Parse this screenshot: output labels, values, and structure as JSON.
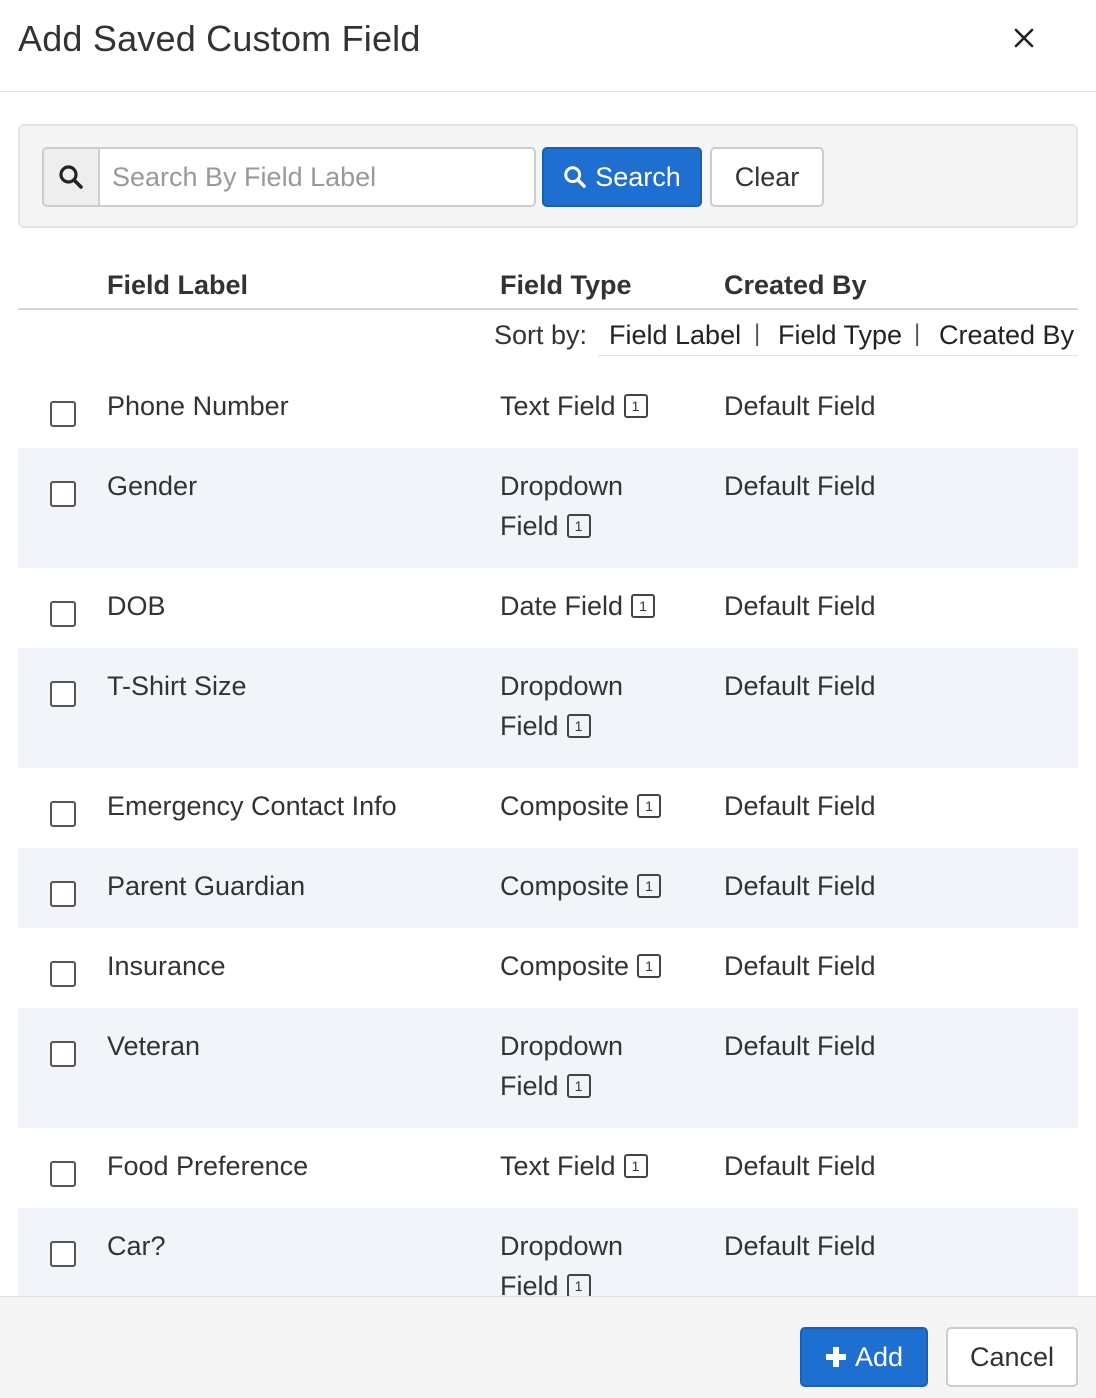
{
  "modal": {
    "title": "Add Saved Custom Field",
    "close_icon": "close-icon"
  },
  "search": {
    "placeholder": "Search By Field Label",
    "value": "",
    "search_label": "Search",
    "clear_label": "Clear"
  },
  "table": {
    "headers": {
      "label": "Field Label",
      "type": "Field Type",
      "created_by": "Created By"
    },
    "sort": {
      "label": "Sort by:",
      "options": [
        "Field Label",
        "Field Type",
        "Created By"
      ],
      "separator": "|"
    },
    "rows": [
      {
        "label": "Phone Number",
        "type_lines": [
          "Text Field"
        ],
        "badge": "1",
        "created_by": "Default Field",
        "checked": false
      },
      {
        "label": "Gender",
        "type_lines": [
          "Dropdown",
          "Field"
        ],
        "badge": "1",
        "created_by": "Default Field",
        "checked": false
      },
      {
        "label": "DOB",
        "type_lines": [
          "Date Field"
        ],
        "badge": "1",
        "created_by": "Default Field",
        "checked": false
      },
      {
        "label": "T-Shirt Size",
        "type_lines": [
          "Dropdown",
          "Field"
        ],
        "badge": "1",
        "created_by": "Default Field",
        "checked": false
      },
      {
        "label": "Emergency Contact Info",
        "type_lines": [
          "Composite"
        ],
        "badge": "1",
        "created_by": "Default Field",
        "checked": false
      },
      {
        "label": "Parent Guardian",
        "type_lines": [
          "Composite"
        ],
        "badge": "1",
        "created_by": "Default Field",
        "checked": false
      },
      {
        "label": "Insurance",
        "type_lines": [
          "Composite"
        ],
        "badge": "1",
        "created_by": "Default Field",
        "checked": false
      },
      {
        "label": "Veteran",
        "type_lines": [
          "Dropdown",
          "Field"
        ],
        "badge": "1",
        "created_by": "Default Field",
        "checked": false
      },
      {
        "label": "Food Preference",
        "type_lines": [
          "Text Field"
        ],
        "badge": "1",
        "created_by": "Default Field",
        "checked": false
      },
      {
        "label": "Car?",
        "type_lines": [
          "Dropdown",
          "Field"
        ],
        "badge": "1",
        "created_by": "Default Field",
        "checked": false
      }
    ]
  },
  "footer": {
    "add_label": "Add",
    "cancel_label": "Cancel"
  },
  "colors": {
    "primary": "#1f6fd0",
    "row_alt": "#f1f5f9",
    "panel": "#f5f5f5"
  }
}
